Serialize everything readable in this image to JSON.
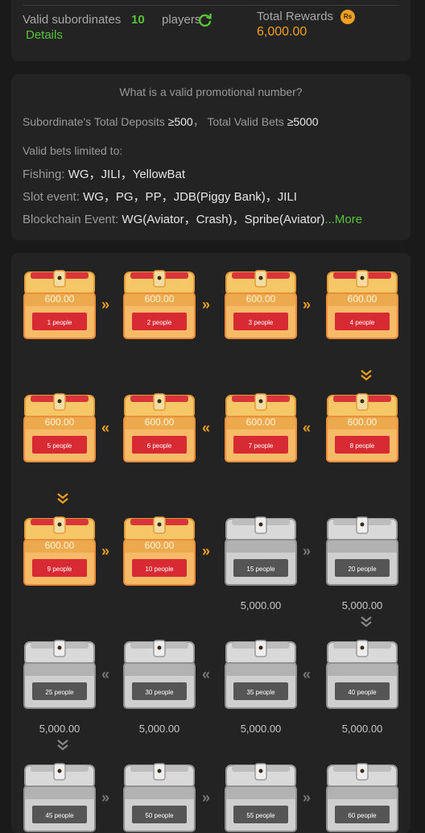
{
  "summary": {
    "subordinates_label": "Valid subordinates",
    "subordinates_count": "10",
    "subordinates_unit": "players",
    "details_link": "Details",
    "total_rewards_label": "Total Rewards",
    "currency_badge": "Rs",
    "total_rewards_value": "6,000.00",
    "colors": {
      "accent_green": "#57c33b",
      "accent_gold": "#f0a020"
    }
  },
  "rules": {
    "title": "What is a valid promotional number?",
    "requirement_deposits_label": "Subordinate's Total Deposits",
    "requirement_deposits_value": "≥500",
    "requirement_bets_label": "Total Valid Bets",
    "requirement_bets_value": "≥5000",
    "limited_label": "Valid bets limited to:",
    "fishing_label": "Fishing:",
    "fishing_value": "WG，JILI，YellowBat",
    "slot_label": "Slot event:",
    "slot_value": "WG，PG，PP，JDB(Piggy Bank)，JILI",
    "blockchain_label": "Blockchain Event:",
    "blockchain_value": "WG(Aviator，Crash)，Spribe(Aviator)",
    "more_link": "...More"
  },
  "chests": [
    {
      "people": "1 people",
      "amount": "600.00",
      "status": "gold"
    },
    {
      "people": "2 people",
      "amount": "600.00",
      "status": "gold"
    },
    {
      "people": "3 people",
      "amount": "600.00",
      "status": "gold"
    },
    {
      "people": "4 people",
      "amount": "600.00",
      "status": "gold"
    },
    {
      "people": "8 people",
      "amount": "600.00",
      "status": "gold"
    },
    {
      "people": "7 people",
      "amount": "600.00",
      "status": "gold"
    },
    {
      "people": "6 people",
      "amount": "600.00",
      "status": "gold"
    },
    {
      "people": "5 people",
      "amount": "600.00",
      "status": "gold"
    },
    {
      "people": "9 people",
      "amount": "600.00",
      "status": "gold"
    },
    {
      "people": "10 people",
      "amount": "600.00",
      "status": "gold"
    },
    {
      "people": "15 people",
      "amount": "5,000.00",
      "status": "silver"
    },
    {
      "people": "20 people",
      "amount": "5,000.00",
      "status": "silver"
    },
    {
      "people": "40 people",
      "amount": "5,000.00",
      "status": "silver"
    },
    {
      "people": "35 people",
      "amount": "5,000.00",
      "status": "silver"
    },
    {
      "people": "30 people",
      "amount": "5,000.00",
      "status": "silver"
    },
    {
      "people": "25 people",
      "amount": "5,000.00",
      "status": "silver"
    },
    {
      "people": "45 people",
      "amount": "",
      "status": "silver"
    },
    {
      "people": "50 people",
      "amount": "",
      "status": "silver"
    },
    {
      "people": "55 people",
      "amount": "",
      "status": "silver"
    },
    {
      "people": "60 people",
      "amount": "",
      "status": "silver"
    }
  ]
}
